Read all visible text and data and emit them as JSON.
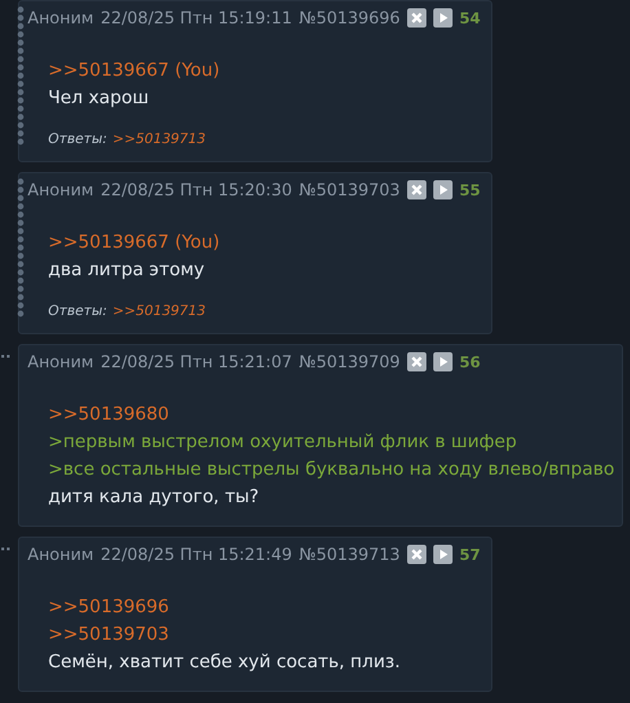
{
  "posts": [
    {
      "kind": "dotted",
      "author": "Аноним",
      "date": "22/08/25 Птн 15:19:11",
      "number": "№50139696",
      "index": "54",
      "lines": [
        {
          "kind": "link",
          "text": ">>50139667 (You)"
        },
        {
          "kind": "text",
          "text": "Чел харош"
        }
      ],
      "replies": {
        "label": "Ответы:",
        "links": [
          ">>50139713"
        ]
      }
    },
    {
      "kind": "dotted",
      "author": "Аноним",
      "date": "22/08/25 Птн 15:20:30",
      "number": "№50139703",
      "index": "55",
      "lines": [
        {
          "kind": "link",
          "text": ">>50139667 (You)"
        },
        {
          "kind": "text",
          "text": "два литра этому"
        }
      ],
      "replies": {
        "label": "Ответы:",
        "links": [
          ">>50139713"
        ]
      }
    },
    {
      "kind": "ellipsis",
      "author": "Аноним",
      "date": "22/08/25 Птн 15:21:07",
      "number": "№50139709",
      "index": "56",
      "lines": [
        {
          "kind": "link",
          "text": ">>50139680"
        },
        {
          "kind": "quote",
          "text": ">первым выстрелом охуительный флик в шифер"
        },
        {
          "kind": "quote",
          "text": ">все остальные выстрелы буквально на ходу влево/вправо"
        },
        {
          "kind": "text",
          "text": "дитя кала дутого, ты?"
        }
      ]
    },
    {
      "kind": "ellipsis",
      "author": "Аноним",
      "date": "22/08/25 Птн 15:21:49",
      "number": "№50139713",
      "index": "57",
      "lines": [
        {
          "kind": "link",
          "text": ">>50139696"
        },
        {
          "kind": "link",
          "text": ">>50139703"
        },
        {
          "kind": "text",
          "text": "Семён, хватит себе хуй сосать, плиз."
        }
      ]
    }
  ]
}
